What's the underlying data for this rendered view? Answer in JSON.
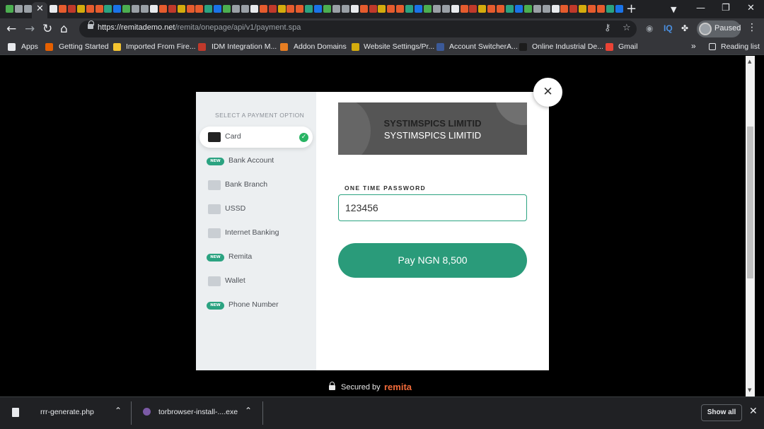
{
  "browser": {
    "url_host": "https://remitademo.net",
    "url_path": "/remita/onepage/api/v1/payment.spa",
    "profile_label": "Paused",
    "extension_iq_label": "IQ",
    "newtab_glyph": "+",
    "bookmarks": [
      {
        "label": "Apps",
        "color": "#e8eaed"
      },
      {
        "label": "Getting Started",
        "color": "#e66000"
      },
      {
        "label": "Imported From Fire...",
        "color": "#f4c430"
      },
      {
        "label": "IDM Integration M...",
        "color": "#c0392b"
      },
      {
        "label": "Addon Domains",
        "color": "#e67e22"
      },
      {
        "label": "Website Settings/Pr...",
        "color": "#d4ac0d"
      },
      {
        "label": "Account SwitcherA...",
        "color": "#3b5998"
      },
      {
        "label": "Online Industrial De...",
        "color": "#1c1c1c"
      },
      {
        "label": "Gmail",
        "color": "#ea4335"
      }
    ],
    "reading_list_label": "Reading list",
    "bookmarks_overflow": "»"
  },
  "modal": {
    "side_title": "SELECT A PAYMENT OPTION",
    "options": [
      {
        "label": "Card",
        "badge": "",
        "active": true
      },
      {
        "label": "Bank Account",
        "badge": "NEW",
        "active": false
      },
      {
        "label": "Bank Branch",
        "badge": "",
        "active": false
      },
      {
        "label": "USSD",
        "badge": "",
        "active": false
      },
      {
        "label": "Internet Banking",
        "badge": "",
        "active": false
      },
      {
        "label": "Remita",
        "badge": "NEW",
        "active": false
      },
      {
        "label": "Wallet",
        "badge": "",
        "active": false
      },
      {
        "label": "Phone Number",
        "badge": "NEW",
        "active": false
      }
    ],
    "merchant_name_line1": "SYSTIMSPICS LIMITID",
    "merchant_name_line2": "SYSTIMSPICS LIMITID",
    "otp_label": "ONE TIME PASSWORD",
    "otp_value": "123456",
    "pay_button_label": "Pay NGN 8,500",
    "close_glyph": "✕",
    "accent_color": "#2a9b7a"
  },
  "footer": {
    "secured_label": "Secured by",
    "brand": "remita"
  },
  "downloads": {
    "items": [
      {
        "name": "rrr-generate.php"
      },
      {
        "name": "torbrowser-install-....exe"
      }
    ],
    "show_all_label": "Show all"
  }
}
